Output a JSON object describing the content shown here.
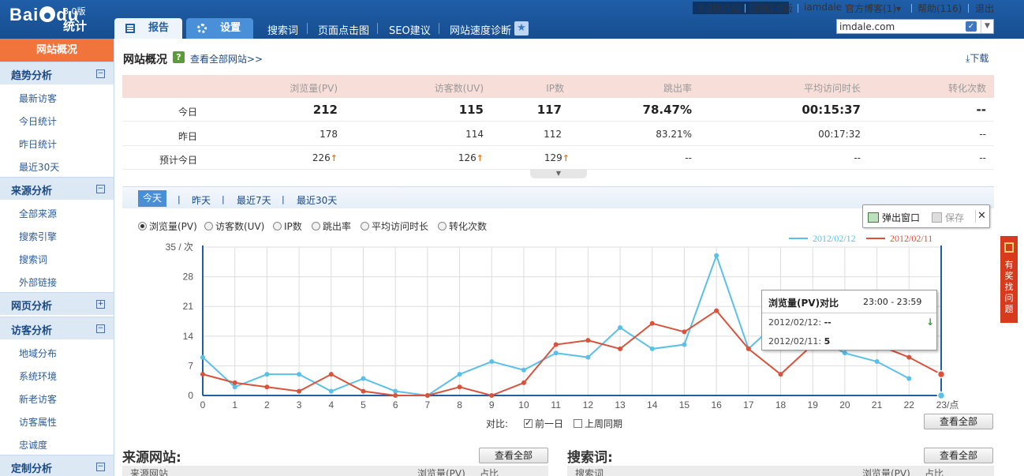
{
  "logo": {
    "brand": "Bai",
    "brand_suffix": "du",
    "product": "统计",
    "version": "3.0版"
  },
  "top_links": {
    "intro": "3.0版介绍",
    "back": "回到2.0版",
    "user": "iamdale",
    "blog": "官方博客(1)▾",
    "help": "帮助(116)",
    "logout": "退出"
  },
  "main_tabs": {
    "report": "报告",
    "settings": "设置"
  },
  "sub_nav": [
    "搜索词",
    "页面点击图",
    "SEO建议",
    "网站速度诊断"
  ],
  "site_select": {
    "value": "imdale.com"
  },
  "sidebar": {
    "overview": "网站概况",
    "sections": [
      {
        "label": "趋势分析",
        "toggle": "⊟",
        "items": [
          "最新访客",
          "今日统计",
          "昨日统计",
          "最近30天"
        ]
      },
      {
        "label": "来源分析",
        "toggle": "⊟",
        "items": [
          "全部来源",
          "搜索引擎",
          "搜索词",
          "外部链接"
        ]
      },
      {
        "label": "网页分析",
        "toggle": "⊞",
        "items": []
      },
      {
        "label": "访客分析",
        "toggle": "⊟",
        "items": [
          "地域分布",
          "系统环境",
          "新老访客",
          "访客属性",
          "忠诚度"
        ]
      },
      {
        "label": "定制分析",
        "toggle": "⊟",
        "items": []
      }
    ]
  },
  "page": {
    "title": "网站概况",
    "help": "?",
    "view_all_sites": "查看全部网站>>",
    "download": "下载"
  },
  "summary": {
    "headers": [
      "浏览量(PV)",
      "访客数(UV)",
      "IP数",
      "跳出率",
      "平均访问时长",
      "转化次数"
    ],
    "rows": [
      {
        "label": "今日",
        "values": [
          "212",
          "115",
          "117",
          "78.47%",
          "00:15:37",
          "--"
        ]
      },
      {
        "label": "昨日",
        "values": [
          "178",
          "114",
          "112",
          "83.21%",
          "00:17:32",
          "--"
        ]
      },
      {
        "label": "预计今日",
        "values": [
          "226",
          "126",
          "129",
          "--",
          "--",
          "--"
        ]
      }
    ]
  },
  "range_tabs": [
    "今天",
    "昨天",
    "最近7天",
    "最近30天"
  ],
  "metric_radios": [
    "浏览量(PV)",
    "访客数(UV)",
    "IP数",
    "跳出率",
    "平均访问时长",
    "转化次数"
  ],
  "float_tools": {
    "popup": "弹出窗口",
    "save": "保存",
    "close": "✕"
  },
  "tooltip": {
    "title": "浏览量(PV)对比",
    "time": "23:00 - 23:59",
    "rows": [
      {
        "label": "2012/02/12:",
        "value": "--"
      },
      {
        "label": "2012/02/11:",
        "value": "5"
      }
    ]
  },
  "compare": {
    "label": "对比:",
    "prev_day": "前一日",
    "last_week": "上周同期",
    "view_all": "查看全部"
  },
  "sections_bottom": {
    "source": {
      "title": "来源网站:",
      "view_all": "查看全部",
      "headers": [
        "来源网站",
        "浏览量(PV)",
        "占比"
      ]
    },
    "keywords": {
      "title": "搜索词:",
      "view_all": "查看全部",
      "headers": [
        "搜索词",
        "浏览量(PV)",
        "占比"
      ]
    }
  },
  "feedback": {
    "label": "有奖找问题"
  },
  "colors": {
    "series_a": "#5bc0e8",
    "series_b": "#d9533c",
    "accent": "#1f5ea8",
    "overview": "#f0743c"
  },
  "chart_data": {
    "type": "line",
    "x": [
      0,
      1,
      2,
      3,
      4,
      5,
      6,
      7,
      8,
      9,
      10,
      11,
      12,
      13,
      14,
      15,
      16,
      17,
      18,
      19,
      20,
      21,
      22,
      23
    ],
    "x_unit": "点",
    "y_unit": "次",
    "ylim": [
      0,
      35
    ],
    "yticks": [
      0,
      7,
      14,
      21,
      28,
      35
    ],
    "grid": true,
    "legend_position": "top-right",
    "series": [
      {
        "name": "2012/02/12",
        "color": "#5bc0e8",
        "values": [
          9,
          2,
          5,
          5,
          1,
          4,
          1,
          0,
          5,
          8,
          6,
          10,
          9,
          16,
          11,
          12,
          33,
          11,
          18,
          14,
          10,
          8,
          4,
          null
        ]
      },
      {
        "name": "2012/02/11",
        "color": "#d9533c",
        "values": [
          5,
          3,
          2,
          1,
          5,
          1,
          0,
          0,
          2,
          0,
          3,
          12,
          13,
          11,
          17,
          15,
          20,
          11,
          5,
          12,
          13,
          12,
          9,
          5
        ]
      }
    ]
  }
}
